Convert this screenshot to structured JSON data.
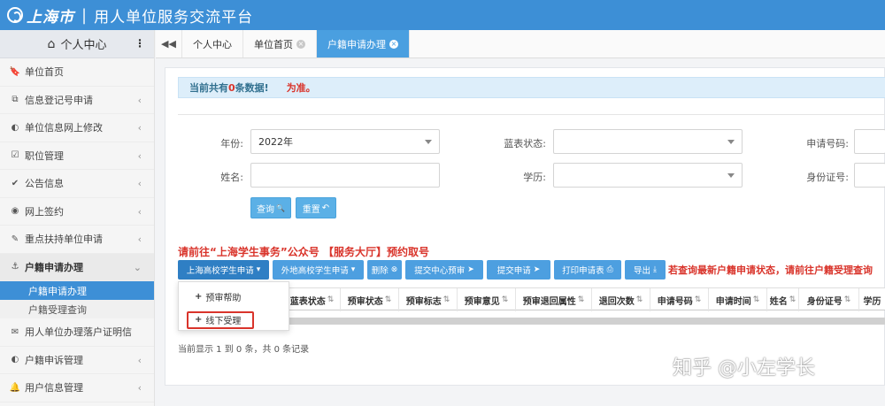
{
  "header": {
    "logo_text": "上海市",
    "separator": "|",
    "title": "用人单位服务交流平台",
    "bg_color": "#3d8fd6"
  },
  "sidebar": {
    "head_label": "个人中心",
    "items": [
      {
        "label": "单位首页",
        "icon": "bookmark-icon",
        "glyph": "🔖",
        "arrow": ""
      },
      {
        "label": "信息登记号申请",
        "icon": "copy-icon",
        "glyph": "⧉",
        "arrow": "‹"
      },
      {
        "label": "单位信息网上修改",
        "icon": "adjust-icon",
        "glyph": "◐",
        "arrow": "‹"
      },
      {
        "label": "职位管理",
        "icon": "checkbox-icon",
        "glyph": "☑",
        "arrow": "‹"
      },
      {
        "label": "公告信息",
        "icon": "check-icon",
        "glyph": "✔",
        "arrow": "‹"
      },
      {
        "label": "网上签约",
        "icon": "eye-icon",
        "glyph": "◉",
        "arrow": "‹"
      },
      {
        "label": "重点扶持单位申请",
        "icon": "pencil-icon",
        "glyph": "✎",
        "arrow": "‹"
      },
      {
        "label": "户籍申请办理",
        "icon": "anchor-icon",
        "glyph": "⚓",
        "arrow": "⌄"
      }
    ],
    "subitems": [
      {
        "label": "户籍申请办理"
      },
      {
        "label": "户籍受理查询"
      }
    ],
    "items_after": [
      {
        "label": "用人单位办理落户证明信",
        "icon": "envelope-icon",
        "glyph": "✉",
        "arrow": ""
      },
      {
        "label": "户籍申诉管理",
        "icon": "adjust-icon",
        "glyph": "◐",
        "arrow": "‹"
      },
      {
        "label": "用户信息管理",
        "icon": "bell-icon",
        "glyph": "🔔",
        "arrow": "‹"
      }
    ]
  },
  "tabs": {
    "nav_glyph": "◀◀",
    "items": [
      {
        "label": "个人中心",
        "closable": false
      },
      {
        "label": "单位首页",
        "closable": true
      },
      {
        "label": "户籍申请办理",
        "closable": true
      }
    ],
    "close_glyph": "×"
  },
  "notice": {
    "prefix": "当前共有",
    "count": "0",
    "suffix": "条数据!",
    "red": "为准。"
  },
  "form": {
    "year_label": "年份:",
    "year_value": "2022年",
    "blue_status_label": "蓝表状态:",
    "blue_status_value": "",
    "app_no_label": "申请号码:",
    "name_label": "姓名:",
    "name_value": "",
    "edu_label": "学历:",
    "edu_value": "",
    "id_label": "身份证号:",
    "id_value": "",
    "query_btn": "查询",
    "query_glyph": "🔍",
    "reset_btn": "重置",
    "reset_glyph": "↶"
  },
  "toolbar": {
    "note": "请前往“上海学生事务”公众号 【服务大厅】预约取号",
    "buttons": [
      {
        "label": "上海高校学生申请",
        "glyph": "▾"
      },
      {
        "label": "外地高校学生申请",
        "glyph": "▾"
      },
      {
        "label": "删除",
        "glyph": "⊗"
      },
      {
        "label": "提交中心预审",
        "glyph": "➤"
      },
      {
        "label": "提交申请",
        "glyph": "➤"
      },
      {
        "label": "打印申请表",
        "glyph": "⎙"
      },
      {
        "label": "导出",
        "glyph": "⤓"
      }
    ],
    "note2": "若查询最新户籍申请状态，请前往户籍受理查询"
  },
  "dropdown": {
    "items": [
      {
        "label": "预审帮助"
      },
      {
        "label": "线下受理"
      }
    ],
    "plus": "+"
  },
  "table": {
    "sort_glyph": "⇅",
    "columns": [
      "蓝表状态",
      "预审状态",
      "预审标志",
      "预审意见",
      "预审退回属性",
      "退回次数",
      "申请号码",
      "申请时间",
      "姓名",
      "身份证号",
      "学历"
    ]
  },
  "footer": {
    "text": "当前显示 1 到 0 条，共 0 条记录"
  },
  "watermark": {
    "text": "知乎 @小左学长"
  }
}
